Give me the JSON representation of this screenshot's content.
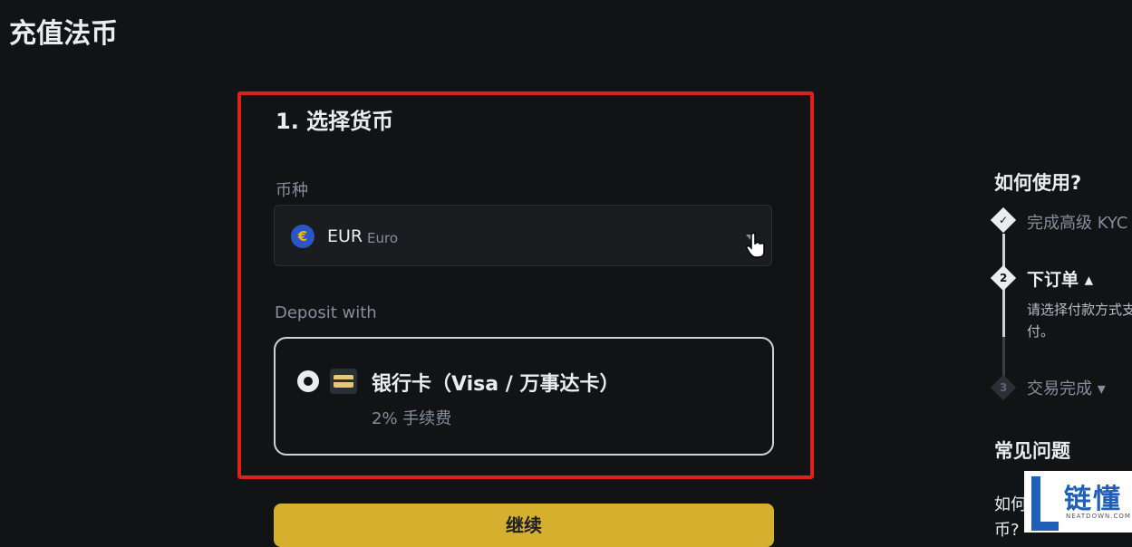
{
  "page": {
    "title": "充值法币"
  },
  "step1": {
    "title": "1. 选择货币",
    "currency_label": "币种",
    "currency": {
      "code": "EUR",
      "name": "Euro",
      "icon": "€"
    },
    "deposit_label": "Deposit with",
    "method": {
      "name": "银行卡（Visa / 万事达卡）",
      "fee": "2% 手续费"
    }
  },
  "continue_label": "继续",
  "howto": {
    "title": "如何使用?",
    "steps": [
      {
        "marker": "✓",
        "label": "完成高级 KYC"
      },
      {
        "marker": "2",
        "label": "下订单 ▴",
        "desc": "请选择付款方式支付。"
      },
      {
        "marker": "3",
        "label": "交易完成 ▾"
      }
    ]
  },
  "faq": {
    "title": "常见问题",
    "first_item": "如何币?"
  },
  "watermark": {
    "text": "链懂",
    "sub": "NEATDOWN.COM"
  },
  "colors": {
    "highlight": "#e0201b",
    "accent": "#d4b02e",
    "background": "#121315"
  }
}
